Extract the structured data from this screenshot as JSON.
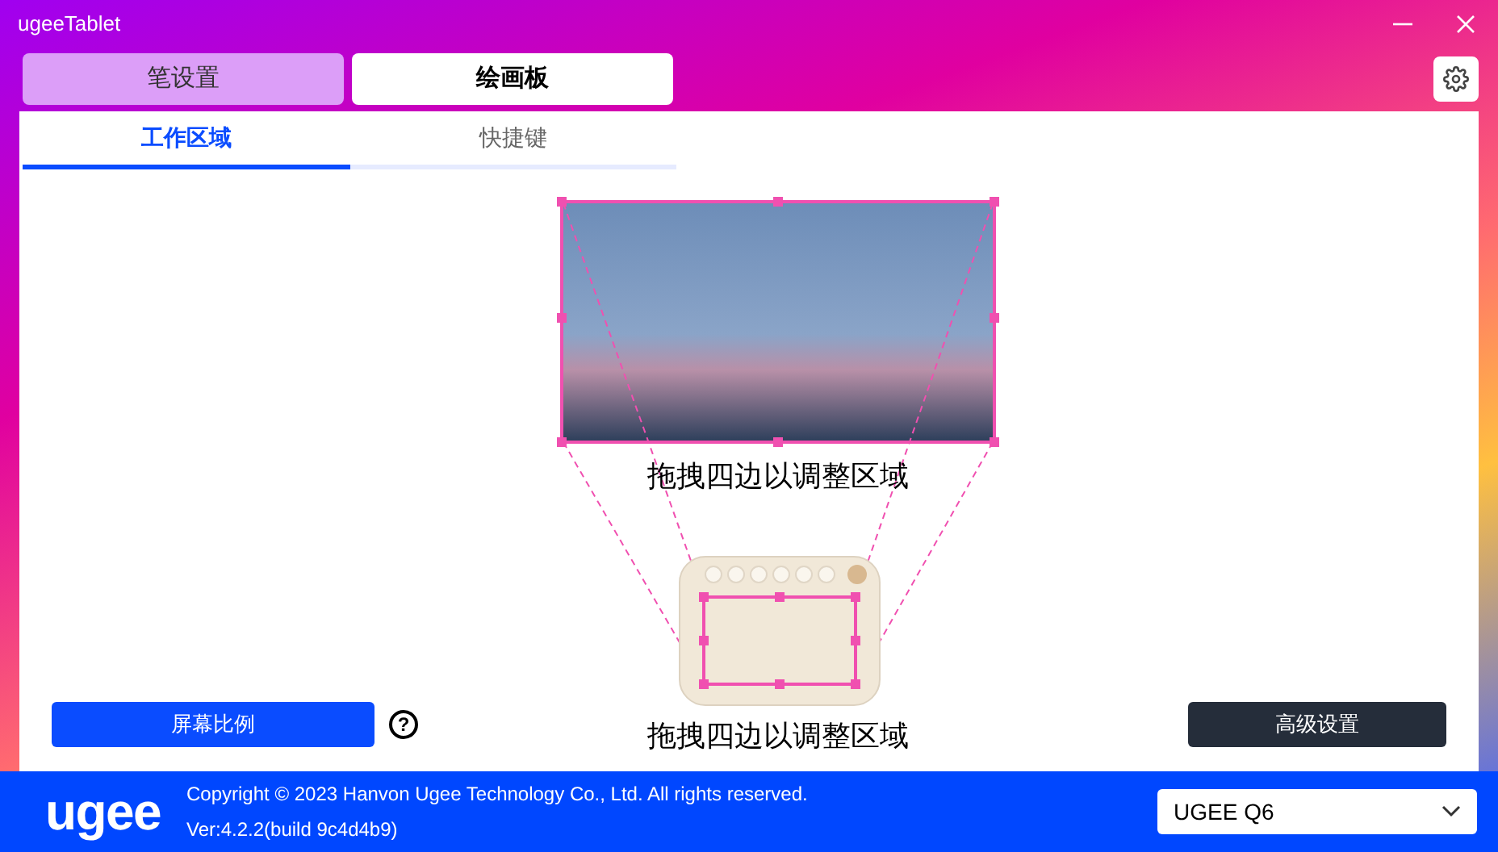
{
  "window": {
    "title": "ugeeTablet"
  },
  "main_tabs": [
    {
      "label": "笔设置",
      "selected": false
    },
    {
      "label": "绘画板",
      "selected": true
    }
  ],
  "sub_tabs": [
    {
      "label": "工作区域",
      "selected": true
    },
    {
      "label": "快捷键",
      "selected": false
    }
  ],
  "screen_area": {
    "hint": "拖拽四边以调整区域"
  },
  "tablet_area": {
    "hint": "拖拽四边以调整区域"
  },
  "buttons": {
    "screen_ratio": "屏幕比例",
    "help": "?",
    "advanced": "高级设置"
  },
  "footer": {
    "logo": "ugee",
    "copyright": "Copyright © 2023 Hanvon Ugee Technology Co., Ltd. All rights reserved.",
    "version": "Ver:4.2.2(build 9c4d4b9)",
    "device": "UGEE Q6"
  }
}
